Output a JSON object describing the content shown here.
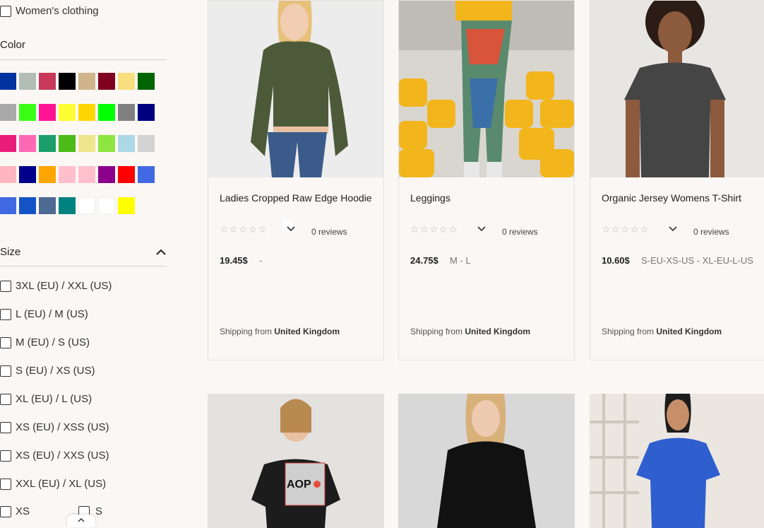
{
  "filters": {
    "category_item": "Women's clothing",
    "color_title": "Color",
    "colors": [
      [
        "#0033a0",
        "#b2beb5",
        "#c8385a",
        "#000000",
        "#d2b48c",
        "#800020",
        "#f8de7e",
        "#006400"
      ],
      [
        "#a9a9a9",
        "#39ff14",
        "#ff1493",
        "#ffff33",
        "#ffd700",
        "#00ff00",
        "#808080",
        "#000080"
      ],
      [
        "#e91e7a",
        "#ff69b4",
        "#1b9e6a",
        "#4cbb17",
        "#f0e68c",
        "#8ee53f",
        "#add8e6",
        "#d3d3d3"
      ],
      [
        "#ffb6c1",
        "#00008b",
        "#ffa500",
        "#ffc0cb",
        "#ffc0cb",
        "#8b008b",
        "#ff0000",
        "#4169e1"
      ],
      [
        "#4169e1",
        "#1353c6",
        "#4c6a92",
        "#00827f",
        "#ffffff",
        "#ffffff",
        "#ffff00"
      ]
    ],
    "size_title": "Size",
    "sizes": [
      "3XL (EU) / XXL (US)",
      "L (EU) / M (US)",
      "M (EU) / S (US)",
      "S (EU) / XS (US)",
      "XL (EU) / L (US)",
      "XS (EU) / XSS (US)",
      "XS (EU) / XXS (US)",
      "XXL (EU) / XL (US)"
    ],
    "size_last_a": "XS",
    "size_last_b": "S"
  },
  "products": [
    {
      "title": "Ladies Cropped Raw Edge Hoodie",
      "stars": "☆☆☆☆☆",
      "reviews": "0 reviews",
      "price": "19.45$",
      "sizes": "-",
      "ship_prefix": "Shipping from",
      "ship_country": "United Kingdom"
    },
    {
      "title": "Leggings",
      "stars": "☆☆☆☆☆",
      "reviews": "0 reviews",
      "price": "24.75$",
      "sizes": "M - L",
      "ship_prefix": "Shipping from",
      "ship_country": "United Kingdom"
    },
    {
      "title": "Organic Jersey Womens T-Shirt",
      "stars": "☆☆☆☆☆",
      "reviews": "0 reviews",
      "price": "10.60$",
      "sizes": "S-EU-XS-US - XL-EU-L-US",
      "ship_prefix": "Shipping from",
      "ship_country": "United Kingdom"
    }
  ],
  "second_row": {
    "logo_text": "AOP"
  },
  "icons": {
    "star": "star-outline-icon",
    "chevron": "chevron-down-icon",
    "collapse": "chevron-up-icon"
  }
}
